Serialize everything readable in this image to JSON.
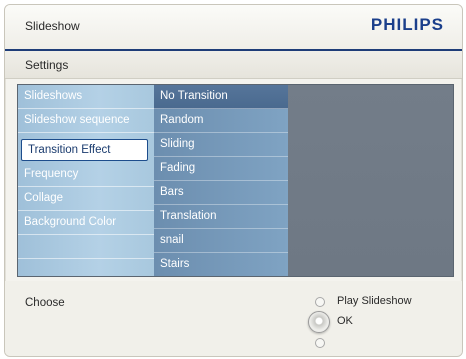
{
  "header": {
    "title": "Slideshow",
    "brand": "PHILIPS"
  },
  "section": {
    "title": "Settings"
  },
  "menu": {
    "items": [
      {
        "label": "Slideshows"
      },
      {
        "label": "Slideshow sequence"
      },
      {
        "label": "Transition Effect",
        "selected": true
      },
      {
        "label": "Frequency"
      },
      {
        "label": "Collage"
      },
      {
        "label": "Background Color"
      },
      {
        "label": ""
      },
      {
        "label": ""
      }
    ]
  },
  "options": {
    "items": [
      {
        "label": "No Transition",
        "highlighted": true
      },
      {
        "label": "Random"
      },
      {
        "label": "Sliding"
      },
      {
        "label": "Fading"
      },
      {
        "label": "Bars"
      },
      {
        "label": "Translation"
      },
      {
        "label": "snail"
      },
      {
        "label": "Stairs"
      }
    ]
  },
  "footer": {
    "hint": "Choose",
    "play_label": "Play Slideshow",
    "ok_label": "OK"
  },
  "colors": {
    "brand": "#1b3f8b",
    "header_rule": "#1e3d78",
    "menu_bg": "#b4d1e6",
    "options_bg": "#7fa3c3",
    "preview_bg": "#737d89"
  }
}
